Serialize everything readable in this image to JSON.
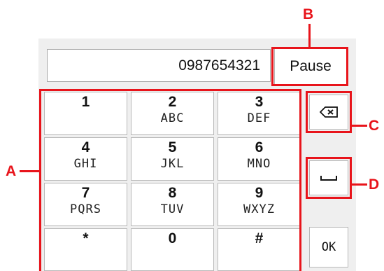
{
  "display": {
    "number": "0987654321"
  },
  "pause_button": {
    "label": "Pause"
  },
  "keypad": [
    {
      "digit": "1",
      "letters": ""
    },
    {
      "digit": "2",
      "letters": "ABC"
    },
    {
      "digit": "3",
      "letters": "DEF"
    },
    {
      "digit": "4",
      "letters": "GHI"
    },
    {
      "digit": "5",
      "letters": "JKL"
    },
    {
      "digit": "6",
      "letters": "MNO"
    },
    {
      "digit": "7",
      "letters": "PQRS"
    },
    {
      "digit": "8",
      "letters": "TUV"
    },
    {
      "digit": "9",
      "letters": "WXYZ"
    },
    {
      "digit": "*",
      "letters": ""
    },
    {
      "digit": "0",
      "letters": ""
    },
    {
      "digit": "#",
      "letters": ""
    }
  ],
  "side_buttons": {
    "backspace_icon": "backspace-icon",
    "space_icon": "space-icon",
    "ok_label": "OK"
  },
  "callouts": {
    "a": "A",
    "b": "B",
    "c": "C",
    "d": "D"
  },
  "colors": {
    "callout": "#e8141b",
    "panel": "#efefef",
    "key": "#ffffff"
  }
}
